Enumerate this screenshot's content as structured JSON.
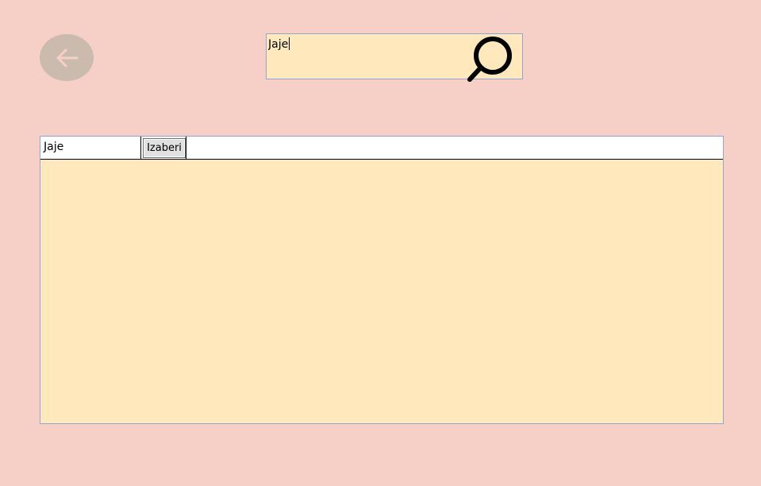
{
  "navigation": {
    "back_icon": "arrow-left-icon"
  },
  "search": {
    "value": "Jaje",
    "icon": "search-icon"
  },
  "results": {
    "items": [
      {
        "name": "Jaje",
        "select_label": "Izaberi"
      }
    ]
  },
  "colors": {
    "background": "#f6cfc6",
    "panel": "#ffe9bc",
    "back_button": "#cbbbaf",
    "border": "#8fa6d6"
  }
}
